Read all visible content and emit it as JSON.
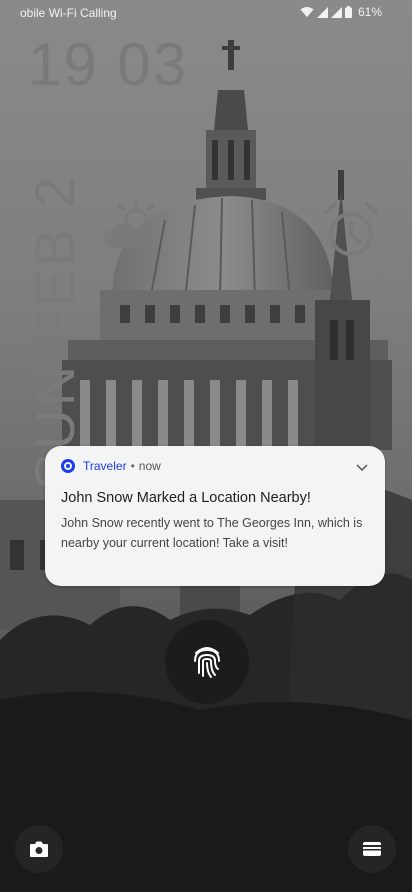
{
  "status_bar": {
    "carrier": "obile Wi-Fi Calling",
    "battery": "61%"
  },
  "lock_screen": {
    "time": "19 03",
    "date": "SUN FEB 2",
    "weather_icon": "partly-cloudy-icon",
    "alarm_icon": "alarm-clock-icon"
  },
  "notification": {
    "app_name": "Traveler",
    "separator": "•",
    "time": "now",
    "title": "John Snow Marked a Location Nearby!",
    "body": "John Snow recently went to The Georges Inn, which is nearby your current location! Take a visit!",
    "accent_color": "#1a3df0"
  },
  "shortcuts": {
    "left_icon": "camera-icon",
    "right_icon": "wallet-icon",
    "center_icon": "fingerprint-icon"
  }
}
